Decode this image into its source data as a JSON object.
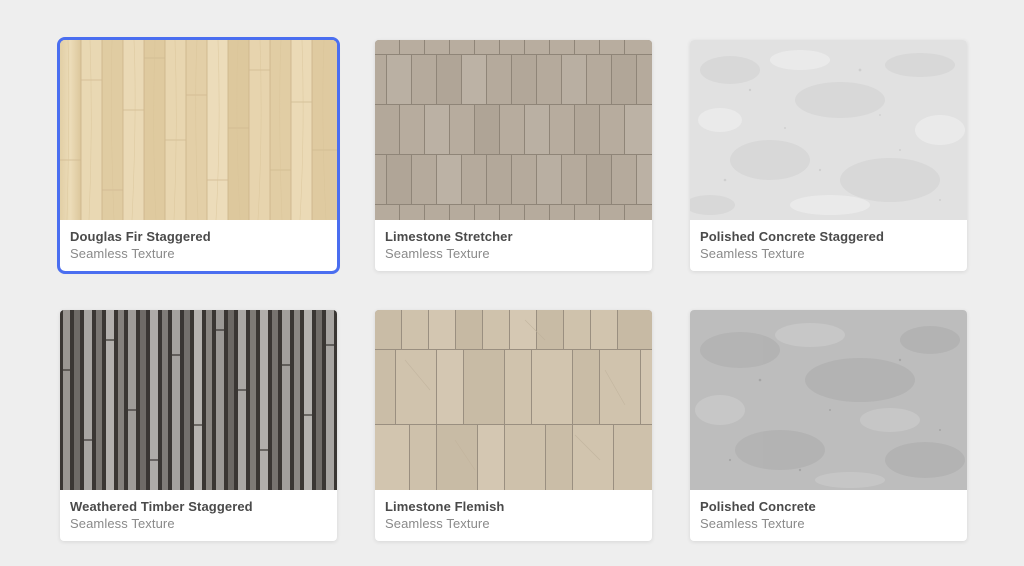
{
  "textures": [
    {
      "title": "Douglas Fir Staggered",
      "subtitle": "Seamless Texture",
      "selected": true
    },
    {
      "title": "Limestone Stretcher",
      "subtitle": "Seamless Texture",
      "selected": false
    },
    {
      "title": "Polished Concrete Staggered",
      "subtitle": "Seamless Texture",
      "selected": false
    },
    {
      "title": "Weathered Timber Staggered",
      "subtitle": "Seamless Texture",
      "selected": false
    },
    {
      "title": "Limestone Flemish",
      "subtitle": "Seamless Texture",
      "selected": false
    },
    {
      "title": "Polished Concrete",
      "subtitle": "Seamless Texture",
      "selected": false
    }
  ],
  "colors": {
    "background": "#eeeeee",
    "selection_outline": "#4a6ef0",
    "title_text": "#4a4a4a",
    "subtitle_text": "#8a8a8a"
  }
}
